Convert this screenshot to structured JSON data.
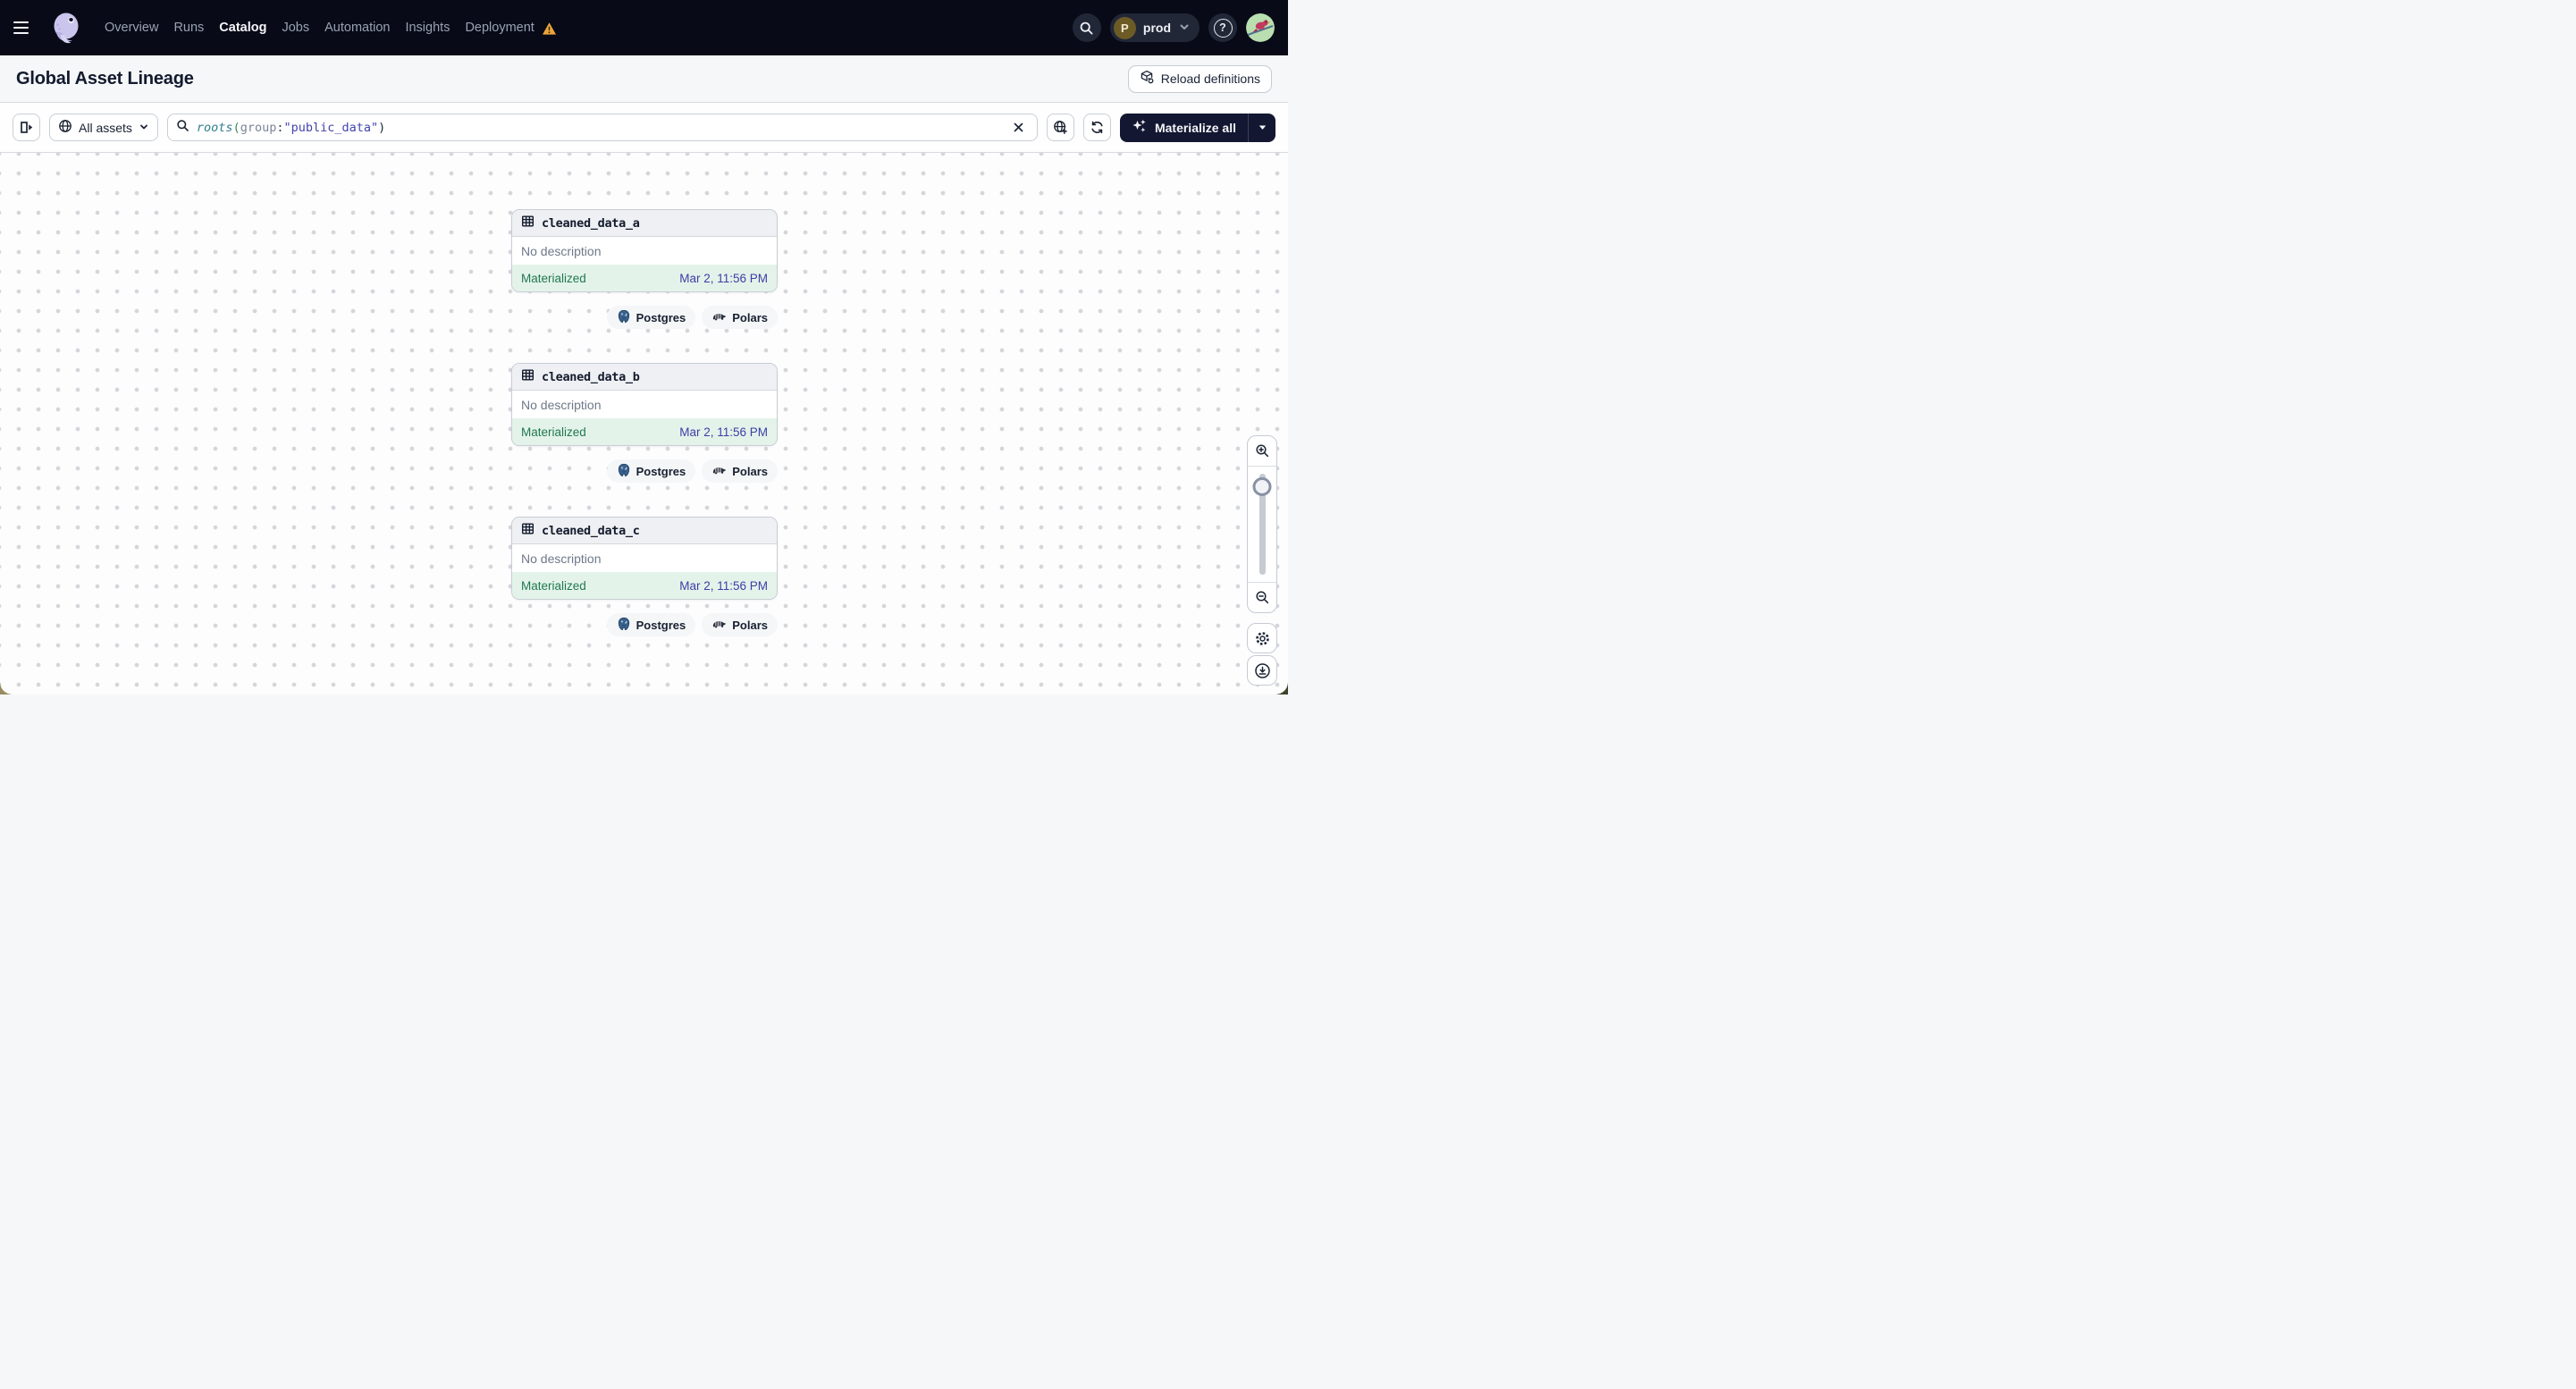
{
  "nav": {
    "items": [
      "Overview",
      "Runs",
      "Catalog",
      "Jobs",
      "Automation",
      "Insights",
      "Deployment"
    ],
    "active_item": "Catalog",
    "environment": {
      "badge_letter": "P",
      "name": "prod"
    },
    "help_glyph": "?"
  },
  "header": {
    "title": "Global Asset Lineage",
    "reload_label": "Reload definitions"
  },
  "toolbar": {
    "scope_label": "All assets",
    "query": {
      "func": "roots",
      "open": "(",
      "key": "group",
      "colon": ":",
      "value": "\"public_data\"",
      "close": ")"
    },
    "materialize_label": "Materialize all"
  },
  "canvas": {
    "nodes": [
      {
        "name": "cleaned_data_a",
        "description": "No description",
        "status": "Materialized",
        "timestamp": "Mar 2, 11:56 PM",
        "tags": [
          "Postgres",
          "Polars"
        ]
      },
      {
        "name": "cleaned_data_b",
        "description": "No description",
        "status": "Materialized",
        "timestamp": "Mar 2, 11:56 PM",
        "tags": [
          "Postgres",
          "Polars"
        ]
      },
      {
        "name": "cleaned_data_c",
        "description": "No description",
        "status": "Materialized",
        "timestamp": "Mar 2, 11:56 PM",
        "tags": [
          "Postgres",
          "Polars"
        ]
      }
    ]
  },
  "colors": {
    "nav_bg": "#080b17",
    "warning": "#efa43a",
    "status_green": "#20794f",
    "status_bg": "#e4f3ea",
    "timestamp_indigo": "#3b3fa6",
    "query_func_teal": "#2f7f8e",
    "query_value_indigo": "#4244ae",
    "materialize_bg": "#131731"
  }
}
